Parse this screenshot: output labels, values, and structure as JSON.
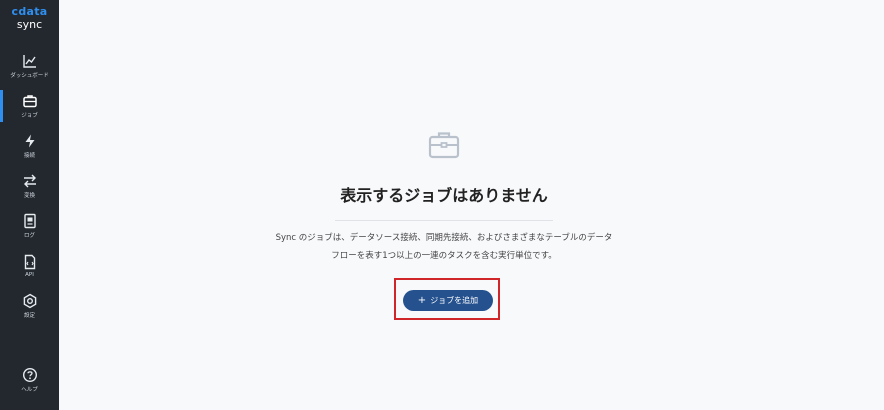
{
  "brand": {
    "logo": "cdata",
    "product": "sync"
  },
  "sidebar": {
    "items": [
      {
        "label": "ダッシュボード",
        "icon": "chart-icon"
      },
      {
        "label": "ジョブ",
        "icon": "briefcase-icon",
        "active": true
      },
      {
        "label": "接続",
        "icon": "lightning-icon"
      },
      {
        "label": "変換",
        "icon": "transform-arrows-icon"
      },
      {
        "label": "ログ",
        "icon": "log-icon"
      },
      {
        "label": "API",
        "icon": "api-document-icon"
      },
      {
        "label": "設定",
        "icon": "gear-icon"
      }
    ],
    "help": {
      "label": "ヘルプ",
      "icon": "question-icon"
    }
  },
  "empty_state": {
    "icon": "briefcase-icon",
    "title": "表示するジョブはありません",
    "description": "Sync のジョブは、データソース接続、同期先接続、およびさまざまなテーブルのデータフローを表す1つ以上の一連のタスクを含む実行単位です。",
    "button_label": "ジョブを追加",
    "button_icon": "plus-icon"
  },
  "colors": {
    "sidebar_bg": "#23282e",
    "accent": "#2f8ff0",
    "button_bg": "#25528f",
    "highlight": "#d0262a"
  }
}
